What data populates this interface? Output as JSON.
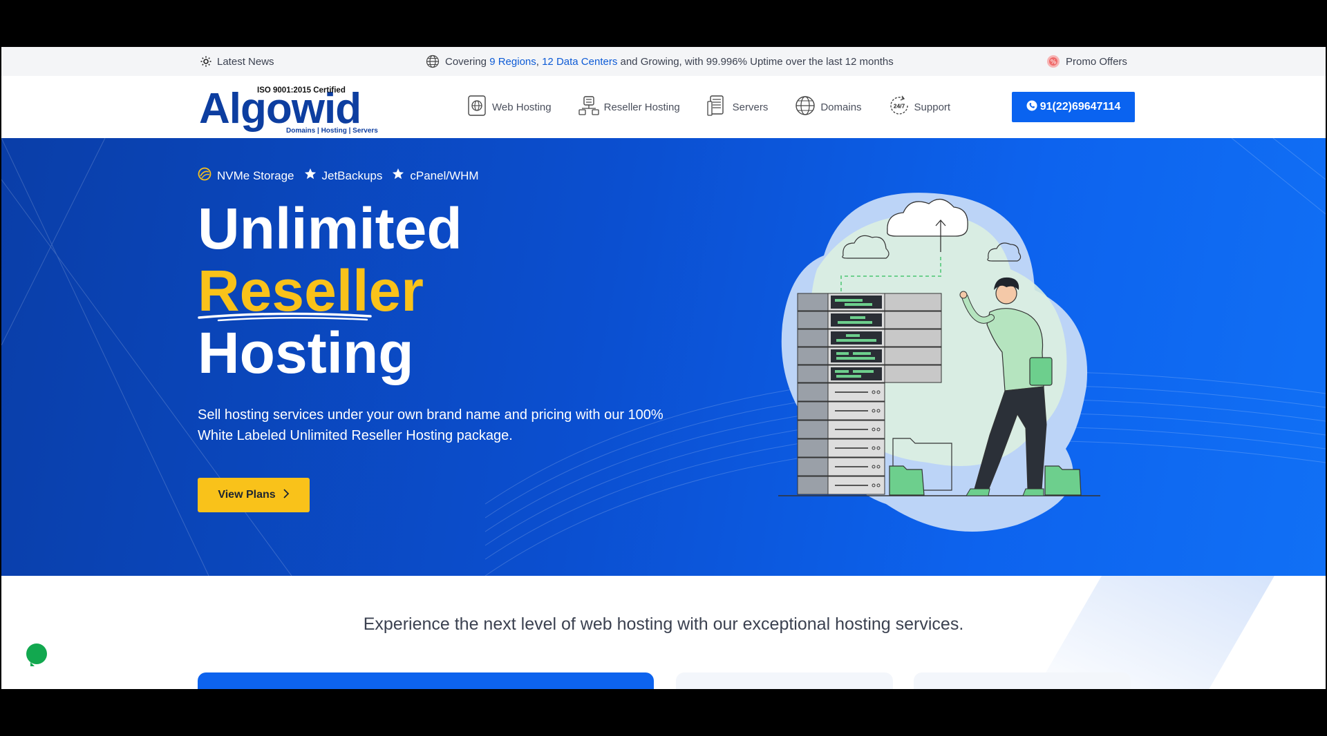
{
  "topbar": {
    "latest_news": "Latest News",
    "coverage_prefix": "Covering ",
    "regions": "9 Regions",
    "comma": ", ",
    "data_centers": "12 Data Centers",
    "coverage_suffix": " and Growing, with 99.996% Uptime over the last 12 months",
    "promo": "Promo Offers"
  },
  "logo": {
    "brand": "Algowid",
    "certification": "ISO 9001:2015 Certified",
    "tagline": "Domains | Hosting | Servers"
  },
  "nav": {
    "items": [
      {
        "label": "Web Hosting",
        "icon": "web-hosting-icon"
      },
      {
        "label": "Reseller Hosting",
        "icon": "reseller-hosting-icon"
      },
      {
        "label": "Servers",
        "icon": "servers-icon"
      },
      {
        "label": "Domains",
        "icon": "globe-icon"
      },
      {
        "label": "Support",
        "icon": "support-24-7-icon"
      }
    ],
    "phone": "91(22)69647114"
  },
  "hero": {
    "features": [
      "NVMe Storage",
      "JetBackups",
      "cPanel/WHM"
    ],
    "title_line1": "Unlimited",
    "title_line2": "Reseller",
    "title_line3": "Hosting",
    "description": "Sell hosting services under your own brand name and pricing with our 100% White Labeled Unlimited Reseller Hosting package.",
    "cta": "View Plans"
  },
  "section": {
    "tagline": "Experience the next level of web hosting with our exceptional hosting services."
  },
  "colors": {
    "primary": "#0a63f0",
    "accent": "#f9c21a",
    "hero_dark": "#0a3ea8"
  }
}
